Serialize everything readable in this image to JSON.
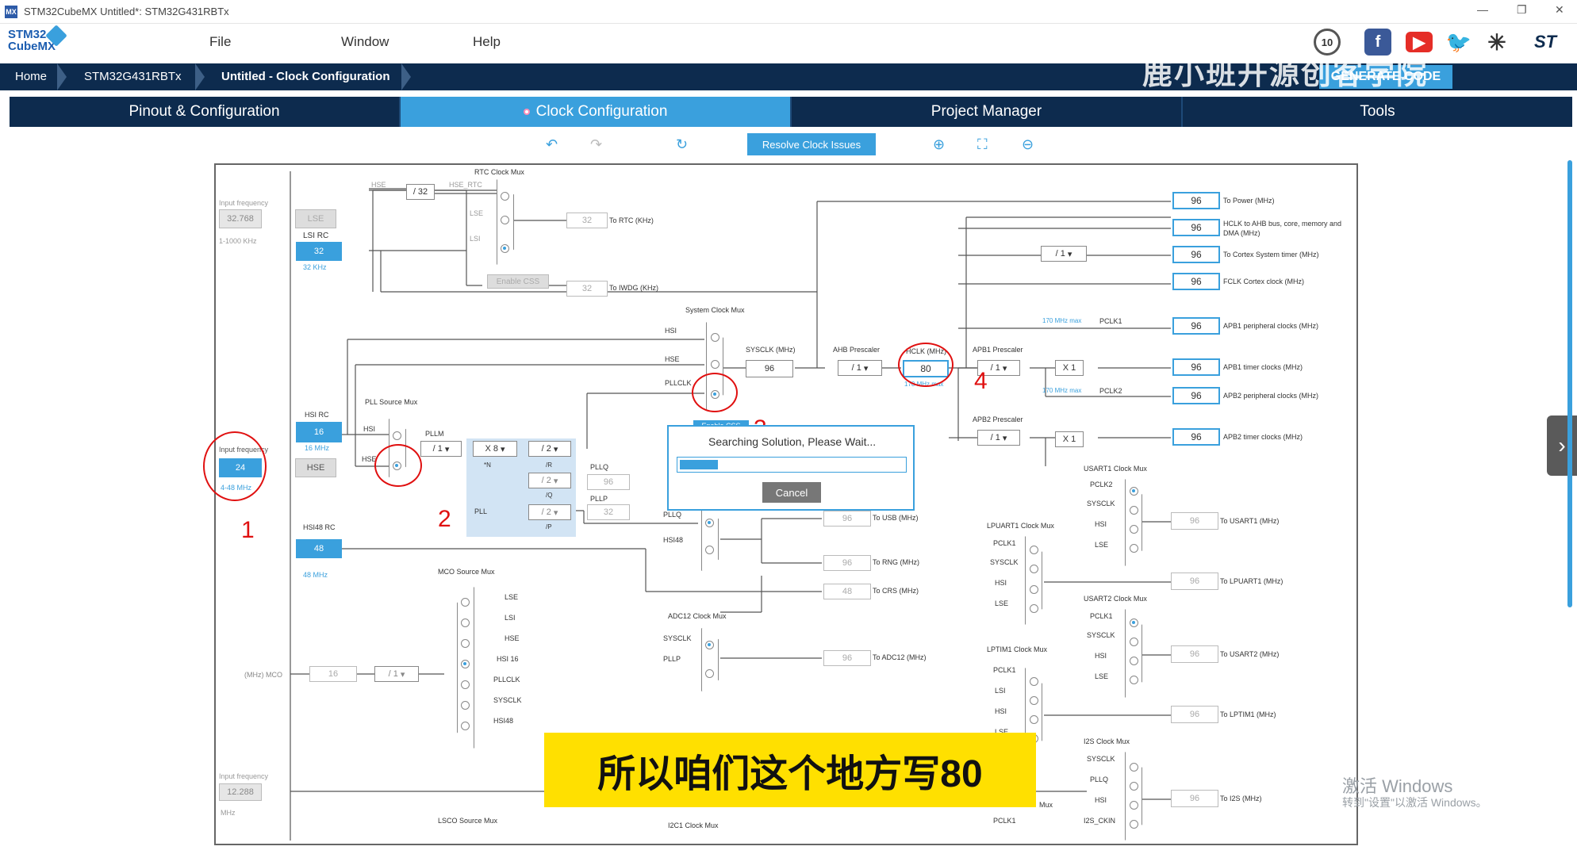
{
  "window": {
    "title": "STM32CubeMX Untitled*: STM32G431RBTx",
    "controls": [
      "—",
      "❐",
      "✕"
    ]
  },
  "logo": {
    "line1": "STM32",
    "line2": "CubeMX"
  },
  "menu": [
    "File",
    "Window",
    "Help"
  ],
  "breadcrumb": [
    "Home",
    "STM32G431RBTx",
    "Untitled - Clock Configuration"
  ],
  "generate_label": "GENERATE CODE",
  "watermark": "鹿小班开源创客学院",
  "tabs": [
    {
      "label": "Pinout & Configuration"
    },
    {
      "label": "Clock Configuration"
    },
    {
      "label": "Project Manager"
    },
    {
      "label": "Tools"
    }
  ],
  "toolbar": {
    "resolve": "Resolve Clock Issues"
  },
  "clock": {
    "input_freq_label": "Input frequency",
    "lse_in": "32.768",
    "lse_range": "1-1000 KHz",
    "lse": "LSE",
    "lsi_rc": "LSI RC",
    "lsi": "32",
    "lsi_unit": "32 KHz",
    "rtc_mux": "RTC Clock Mux",
    "hse_label": "HSE",
    "div32": "/ 32",
    "hse_rtc": "HSE_RTC",
    "lse_s": "LSE",
    "lsi_s": "LSI",
    "rtc_val": "32",
    "rtc_out": "To RTC (KHz)",
    "enable_css": "Enable CSS",
    "iwdg_val": "32",
    "iwdg_out": "To IWDG (KHz)",
    "sys_mux": "System Clock Mux",
    "hsi_s": "HSI",
    "hse_s": "HSE",
    "pllclk": "PLLCLK",
    "sysclk_label": "SYSCLK (MHz)",
    "sysclk": "96",
    "ahb_label": "AHB Prescaler",
    "ahb": "/ 1",
    "hclk_label": "HCLK (MHz)",
    "hclk": "80",
    "hclk_max": "170 MHz max",
    "apb1_label": "APB1 Prescaler",
    "apb1": "/ 1",
    "x1": "X 1",
    "apb2_label": "APB2 Prescaler",
    "apb2": "/ 1",
    "max170": "170 MHz max",
    "pclk1": "PCLK1",
    "pclk2": "PCLK2",
    "cortex_div": "/ 1",
    "outputs": [
      {
        "val": "96",
        "label": "To Power (MHz)"
      },
      {
        "val": "96",
        "label": "HCLK to AHB bus, core, memory and DMA (MHz)"
      },
      {
        "val": "96",
        "label": "To Cortex System timer (MHz)"
      },
      {
        "val": "96",
        "label": "FCLK Cortex clock (MHz)"
      },
      {
        "val": "96",
        "label": "APB1 peripheral clocks (MHz)"
      },
      {
        "val": "96",
        "label": "APB1 timer clocks (MHz)"
      },
      {
        "val": "96",
        "label": "APB2 peripheral clocks (MHz)"
      },
      {
        "val": "96",
        "label": "APB2 timer clocks (MHz)"
      }
    ],
    "hsi_rc": "HSI RC",
    "hsi": "16",
    "hsi_unit": "16 MHz",
    "pll_src": "PLL Source Mux",
    "hsi_p": "HSI",
    "hse_p": "HSE",
    "hse_in_label": "Input frequency",
    "hse_in": "24",
    "hse_range": "4-48 MHz",
    "hse_box": "HSE",
    "pllm_label": "PLLM",
    "pllm": "/ 1",
    "n": "X 8",
    "n_label": "*N",
    "r": "/ 2",
    "r_label": "/R",
    "q": "/ 2",
    "q_label": "/Q",
    "p": "/ 2",
    "p_label": "/P",
    "pll_label": "PLL",
    "pllq": "PLLQ",
    "pllq_val": "96",
    "pllp": "PLLP",
    "pllp_val": "32",
    "hsi48_rc": "HSI48 RC",
    "hsi48": "48",
    "hsi48_unit": "48 MHz",
    "pllq_m": "PLLQ",
    "hsi48_m": "HSI48",
    "usb_val": "96",
    "usb_out": "To USB (MHz)",
    "rng_val": "96",
    "rng_out": "To RNG (MHz)",
    "crs_val": "48",
    "crs_out": "To CRS (MHz)",
    "mco_mux": "MCO Source Mux",
    "mco_items": [
      "LSE",
      "LSI",
      "HSE",
      "HSI 16",
      "PLLCLK",
      "SYSCLK",
      "HSI48"
    ],
    "mco_label": "(MHz) MCO",
    "mco_val": "16",
    "mco_div": "/ 1",
    "adc_mux": "ADC12 Clock Mux",
    "adc_sysclk": "SYSCLK",
    "adc_pllp": "PLLP",
    "adc_val": "96",
    "adc_out": "To ADC12 (MHz)",
    "lsco": "LSCO Source Mux",
    "i2c1": "I2C1 Clock Mux",
    "in2_label": "Input frequency",
    "in2": "12.288",
    "in2_unit": "MHz",
    "usart1_mux": "USART1 Clock Mux",
    "usart1_items": [
      "PCLK2",
      "SYSCLK",
      "HSI",
      "LSE"
    ],
    "usart1_val": "96",
    "usart1_out": "To USART1 (MHz)",
    "lpuart_mux": "LPUART1 Clock Mux",
    "lpuart_items": [
      "PCLK1",
      "SYSCLK",
      "HSI",
      "LSE"
    ],
    "lpuart_val": "96",
    "lpuart_out": "To LPUART1 (MHz)",
    "usart2_mux": "USART2 Clock Mux",
    "usart2_items": [
      "PCLK1",
      "SYSCLK",
      "HSI",
      "LSE"
    ],
    "usart2_val": "96",
    "usart2_out": "To USART2 (MHz)",
    "lptim_mux": "LPTIM1 Clock Mux",
    "lptim_items": [
      "PCLK1",
      "LSI",
      "HSI",
      "LSE"
    ],
    "lptim_val": "96",
    "lptim_out": "To LPTIM1 (MHz)",
    "i2s_mux": "I2S Clock Mux",
    "i2s_items": [
      "SYSCLK",
      "PLLQ",
      "HSI",
      "I2S_CKIN"
    ],
    "i2s_val": "96",
    "i2s_out": "To I2S (MHz)",
    "enable_css2": "Enable CSS",
    "bottom_mux_fragment": "Mux",
    "bottom_pclk1": "PCLK1"
  },
  "dialog": {
    "message": "Searching Solution, Please Wait...",
    "progress": 0.17,
    "cancel": "Cancel"
  },
  "annotations": [
    "1",
    "2",
    "3",
    "4"
  ],
  "subtitle": "所以咱们这个地方写80",
  "activation": {
    "line1": "激活 Windows",
    "line2": "转到\"设置\"以激活 Windows。"
  }
}
